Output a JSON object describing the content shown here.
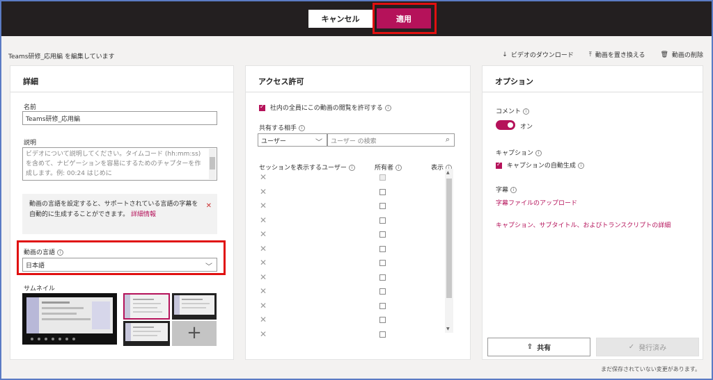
{
  "header": {
    "cancel_label": "キャンセル",
    "apply_label": "適用"
  },
  "toolbar": {
    "editing_title": "Teams研修_応用編 を編集しています",
    "download_label": "ビデオのダウンロード",
    "replace_label": "動画を置き換える",
    "delete_label": "動画の削除"
  },
  "details": {
    "title": "詳細",
    "name_label": "名前",
    "name_value": "Teams研修_応用編",
    "description_label": "説明",
    "description_placeholder": "ビデオについて説明してください。タイムコード (hh:mm:ss) を含めて、ナビゲーションを容易にするためのチャプターを作成します。例: 00:24 はじめに",
    "info_text": "動画の言語を設定すると、サポートされている言語の字幕を自動的に生成することができます。",
    "info_link": "詳細情報",
    "language_label": "動画の言語",
    "language_value": "日本語",
    "thumbnail_label": "サムネイル"
  },
  "access": {
    "title": "アクセス許可",
    "allow_all_label": "社内の全員にこの動画の閲覧を許可する",
    "share_with_label": "共有する相手",
    "share_type_value": "ユーザー",
    "search_placeholder": "ユーザー の検索",
    "col_user": "セッションを表示するユーザー",
    "col_owner": "所有者",
    "col_view": "表示"
  },
  "options": {
    "title": "オプション",
    "comment_label": "コメント",
    "comment_state": "オン",
    "caption_label": "キャプション",
    "autogen_label": "キャプションの自動生成",
    "subtitle_label": "字幕",
    "upload_link": "字幕ファイルのアップロード",
    "details_link": "キャプション、サブタイトル、およびトランスクリプトの詳細"
  },
  "footer": {
    "share_label": "共有",
    "published_label": "発行済み",
    "unsaved_text": "まだ保存されていない変更があります。"
  }
}
